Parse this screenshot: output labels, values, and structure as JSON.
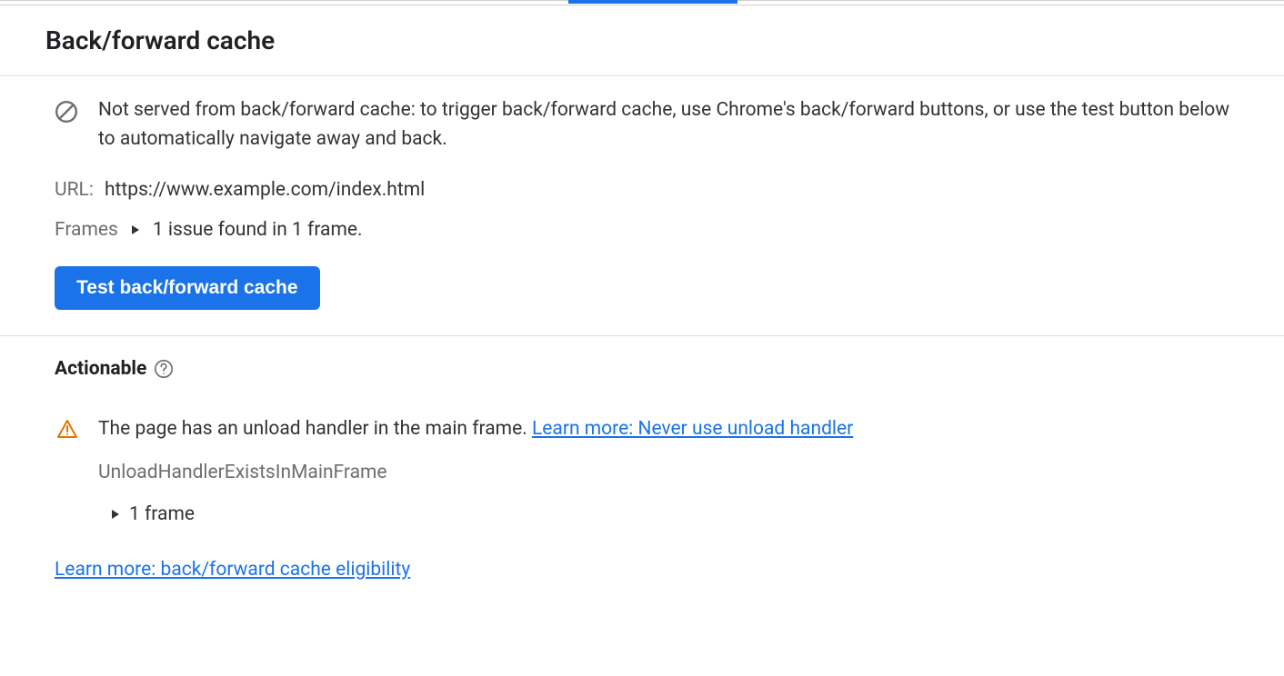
{
  "header": {
    "title": "Back/forward cache"
  },
  "info": {
    "message": "Not served from back/forward cache: to trigger back/forward cache, use Chrome's back/forward buttons, or use the test button below to automatically navigate away and back."
  },
  "url": {
    "label": "URL:",
    "value": "https://www.example.com/index.html"
  },
  "frames": {
    "label": "Frames",
    "summary": "1 issue found in 1 frame."
  },
  "test_button": {
    "label": "Test back/forward cache"
  },
  "actionable": {
    "heading": "Actionable",
    "issue": {
      "message": "The page has an unload handler in the main frame. ",
      "link_text": "Learn more: Never use unload handler",
      "code": "UnloadHandlerExistsInMainFrame",
      "frame_count": "1 frame"
    },
    "footer_link": "Learn more: back/forward cache eligibility"
  }
}
